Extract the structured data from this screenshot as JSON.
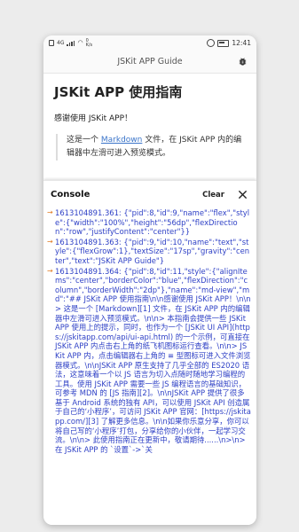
{
  "status_bar": {
    "network": "4G",
    "speed": "0\nK/s",
    "time": "12:41"
  },
  "app_bar": {
    "title": "JSKit APP Guide",
    "debug_icon": "bug-icon"
  },
  "document": {
    "heading": "JSKit APP 使用指南",
    "greeting": "感谢使用 JSKit APP！",
    "quote_before_link": "这是一个 ",
    "quote_link": "Markdown",
    "quote_after_link": " 文件，在 JSKit APP 内的编辑器中左滑可进入预览模式。"
  },
  "console": {
    "title": "Console",
    "clear_label": "Clear",
    "close_icon": "close-icon",
    "entries": [
      {
        "arrow": "→",
        "text": "1613104891.361: {\"pid\":8,\"id\":9,\"name\":\"flex\",\"style\":{\"width\":\"100%\",\"height\":\"56dp\",\"flexDirection\":\"row\",\"justifyContent\":\"center\"}}"
      },
      {
        "arrow": "→",
        "text": "1613104891.363: {\"pid\":9,\"id\":10,\"name\":\"text\",\"style\":{\"flexGrow\":1},\"textSize\":\"17sp\",\"gravity\":\"center\",\"text\":\"JSKit APP Guide\"}"
      },
      {
        "arrow": "→",
        "text": "1613104891.364: {\"pid\":8,\"id\":11,\"style\":{\"alignItems\":\"center\",\"borderColor\":\"blue\",\"flexDirection\":\"column\",\"borderWidth\":\"2dp\"},\"name\":\"md-view\",\"md\":\"## JSKit APP 使用指南\\n\\n感谢使用 JSKit APP！\\n\\n> 这是一个 [Markdown][1] 文件，在 JSKit APP 内的编辑器中左滑可进入预览模式。\\n\\n> 本指南会提供一些 JSKit APP 使用上的提示，同时，也作为一个 [JSKit UI API](https://jskitapp.com/api/ui-api.html) 的一个示例，可直接在 JSKit APP 内点击右上角的纸飞机图标运行查看。\\n\\n> JSKit APP 内，点击编辑器右上角的 ≡ 型图标可进入文件浏览器模式。\\n\\nJSKit APP 原生支持了几乎全部的 ES2020 语法，这意味着一个以 JS 语言为切入点随时随地学习编程的工具。使用 JSKit APP 需要一些 JS 编程语言的基础知识，可参考 MDN 的 [JS 指南][2]。\\n\\nJSKit APP 提供了很多基于 Android 系统的独有 API，可以使用 JSKit API 创造属于自己的‘小程序’，可访问 JSKit APP 官网：[https://jskitapp.com/][3] 了解更多信息。\\n\\n如果你乐意分享，你可以将自己写的‘小程序’打包，分享给你的小伙伴，一起学习交流。\\n\\n> 此使用指南正在更新中，敬请期待......\\n>\\n> 在 JSKit APP 的 `设置`->`关"
      }
    ]
  }
}
